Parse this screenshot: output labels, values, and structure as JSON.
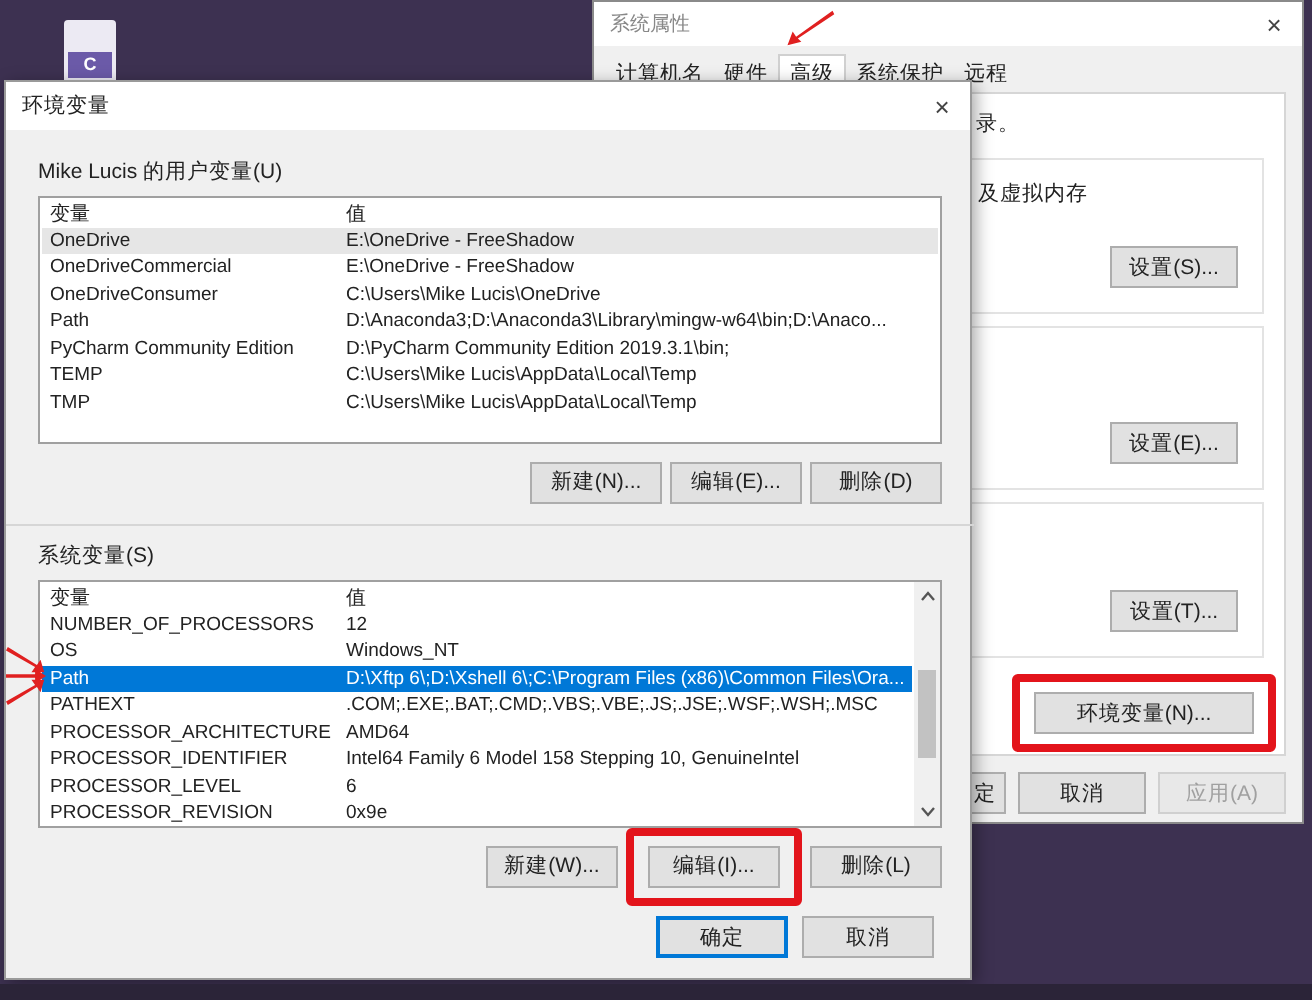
{
  "desktop": {
    "file_icon_label": "C"
  },
  "back_window": {
    "title": "系统属性",
    "close": "×",
    "tabs": [
      {
        "label": "计算机名",
        "selected": false
      },
      {
        "label": "硬件",
        "selected": false
      },
      {
        "label": "高级",
        "selected": true
      },
      {
        "label": "系统保护",
        "selected": false
      },
      {
        "label": "远程",
        "selected": false
      }
    ],
    "intro_text": "录。",
    "groups": [
      {
        "text": "及虚拟内存",
        "button": "设置(S)..."
      },
      {
        "button": "设置(E)..."
      },
      {
        "button": "设置(T)..."
      }
    ],
    "env_button": {
      "label": "环境变量(N)...",
      "highlighted": true
    },
    "footer_buttons": [
      {
        "label": "定",
        "disabled": false
      },
      {
        "label": "取消",
        "disabled": false
      },
      {
        "label": "应用(A)",
        "disabled": true
      }
    ]
  },
  "dialog": {
    "title": "环境变量",
    "close": "×",
    "user_group": {
      "label": "Mike Lucis 的用户变量(U)",
      "focused": false,
      "columns": [
        "变量",
        "值"
      ],
      "rows": [
        {
          "name": "OneDrive",
          "value": "E:\\OneDrive - FreeShadow",
          "selected": true
        },
        {
          "name": "OneDriveCommercial",
          "value": "E:\\OneDrive - FreeShadow",
          "selected": false
        },
        {
          "name": "OneDriveConsumer",
          "value": "C:\\Users\\Mike Lucis\\OneDrive",
          "selected": false
        },
        {
          "name": "Path",
          "value": "D:\\Anaconda3;D:\\Anaconda3\\Library\\mingw-w64\\bin;D:\\Anaco...",
          "selected": false
        },
        {
          "name": "PyCharm Community Edition",
          "value": "D:\\PyCharm Community Edition 2019.3.1\\bin;",
          "selected": false
        },
        {
          "name": "TEMP",
          "value": "C:\\Users\\Mike Lucis\\AppData\\Local\\Temp",
          "selected": false
        },
        {
          "name": "TMP",
          "value": "C:\\Users\\Mike Lucis\\AppData\\Local\\Temp",
          "selected": false
        }
      ],
      "buttons": [
        {
          "label": "新建(N)...",
          "highlighted": false
        },
        {
          "label": "编辑(E)...",
          "highlighted": false
        },
        {
          "label": "删除(D)",
          "highlighted": false
        }
      ]
    },
    "system_group": {
      "label": "系统变量(S)",
      "focused": true,
      "columns": [
        "变量",
        "值"
      ],
      "rows": [
        {
          "name": "NUMBER_OF_PROCESSORS",
          "value": "12",
          "selected": false
        },
        {
          "name": "OS",
          "value": "Windows_NT",
          "selected": false
        },
        {
          "name": "Path",
          "value": "D:\\Xftp 6\\;D:\\Xshell 6\\;C:\\Program Files (x86)\\Common Files\\Ora...",
          "selected": true
        },
        {
          "name": "PATHEXT",
          "value": ".COM;.EXE;.BAT;.CMD;.VBS;.VBE;.JS;.JSE;.WSF;.WSH;.MSC",
          "selected": false
        },
        {
          "name": "PROCESSOR_ARCHITECTURE",
          "value": "AMD64",
          "selected": false
        },
        {
          "name": "PROCESSOR_IDENTIFIER",
          "value": "Intel64 Family 6 Model 158 Stepping 10, GenuineIntel",
          "selected": false
        },
        {
          "name": "PROCESSOR_LEVEL",
          "value": "6",
          "selected": false
        },
        {
          "name": "PROCESSOR_REVISION",
          "value": "0x9e",
          "selected": false
        }
      ],
      "buttons": [
        {
          "label": "新建(W)...",
          "highlighted": false
        },
        {
          "label": "编辑(I)...",
          "highlighted": true
        },
        {
          "label": "删除(L)",
          "highlighted": false
        }
      ]
    },
    "footer_buttons": [
      {
        "label": "确定",
        "default": true
      },
      {
        "label": "取消",
        "default": false
      }
    ]
  }
}
